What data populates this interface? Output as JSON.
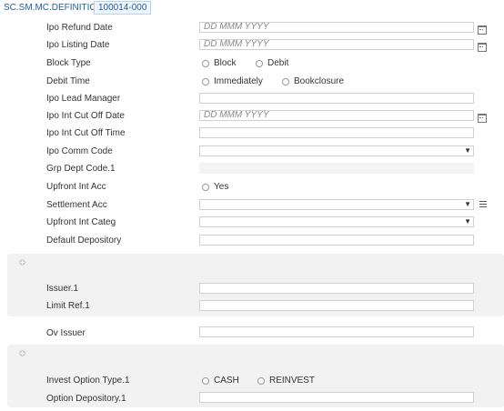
{
  "header": {
    "app_title": "SC.SM.MC.DEFINITION",
    "record_id": "100014-000"
  },
  "fields": {
    "ipo_refund_date": {
      "label": "Ipo Refund Date",
      "placeholder": "DD MMM YYYY"
    },
    "ipo_listing_date": {
      "label": "Ipo Listing Date",
      "placeholder": "DD MMM YYYY"
    },
    "block_type": {
      "label": "Block Type",
      "options": [
        "Block",
        "Debit"
      ]
    },
    "debit_time": {
      "label": "Debit Time",
      "options": [
        "Immediately",
        "Bookclosure"
      ]
    },
    "ipo_lead_manager": {
      "label": "Ipo Lead Manager",
      "value": ""
    },
    "ipo_int_cut_off_date": {
      "label": "Ipo Int Cut Off Date",
      "placeholder": "DD MMM YYYY"
    },
    "ipo_int_cut_off_time": {
      "label": "Ipo Int Cut Off Time",
      "value": ""
    },
    "ipo_comm_code": {
      "label": "Ipo Comm Code",
      "value": ""
    },
    "grp_dept_code": {
      "label": "Grp Dept Code.1",
      "value": ""
    },
    "upfront_int_acc": {
      "label": "Upfront Int Acc",
      "options": [
        "Yes"
      ]
    },
    "settlement_acc": {
      "label": "Settlement Acc",
      "value": ""
    },
    "upfront_int_categ": {
      "label": "Upfront Int Categ",
      "value": ""
    },
    "default_depository": {
      "label": "Default Depository",
      "value": ""
    },
    "issuer": {
      "label": "Issuer.1",
      "value": ""
    },
    "limit_ref": {
      "label": "Limit Ref.1",
      "value": ""
    },
    "ov_issuer": {
      "label": "Ov Issuer",
      "value": ""
    },
    "invest_option_type": {
      "label": "Invest Option Type.1",
      "options": [
        "CASH",
        "REINVEST"
      ]
    },
    "option_depository": {
      "label": "Option Depository.1",
      "value": ""
    }
  },
  "icons": {
    "calendar": "calendar-icon",
    "dropdown": "caret-down-icon",
    "list": "list-icon",
    "add": "add-group-icon"
  },
  "colors": {
    "accent": "#1f5fa8",
    "panel": "#f2f2f2",
    "field_border": "#d0d0d0"
  }
}
